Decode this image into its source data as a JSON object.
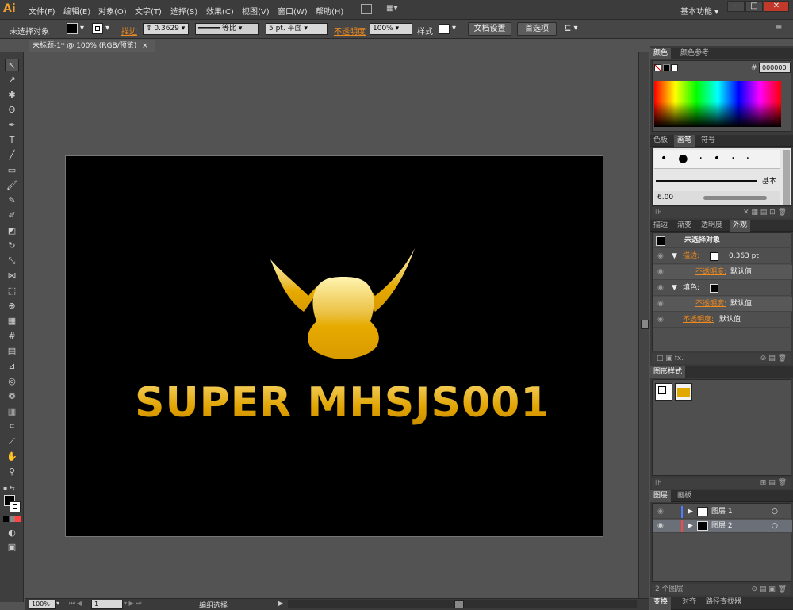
{
  "app": {
    "logo": "Ai",
    "workspace": "基本功能"
  },
  "menu": [
    "文件(F)",
    "编辑(E)",
    "对象(O)",
    "文字(T)",
    "选择(S)",
    "效果(C)",
    "视图(V)",
    "窗口(W)",
    "帮助(H)"
  ],
  "window_buttons": {
    "min": "–",
    "max": "□",
    "close": "✕"
  },
  "control": {
    "selection": "未选择对象",
    "stroke_label": "描边",
    "stroke_value": "0.3629",
    "stroke_profile": "等比",
    "brush": "5 pt. 平面",
    "opacity_label": "不透明度",
    "opacity_value": "100%",
    "style_label": "样式",
    "doc_setup": "文档设置",
    "prefs": "首选项"
  },
  "doc_tab": {
    "title": "未标题-1* @ 100% (RGB/预览)",
    "close": "×"
  },
  "artwork": {
    "text": "SUPER MHSJS001",
    "gold_light": "#f7d56a",
    "gold_dark": "#e0a300"
  },
  "color_panel": {
    "tabs": [
      "颜色",
      "颜色参考"
    ],
    "hex_label": "#",
    "hex": "000000"
  },
  "brush_panel": {
    "tabs": [
      "色板",
      "画笔",
      "符号"
    ],
    "basic": "基本",
    "size": "6.00"
  },
  "appearance": {
    "tabs": [
      "描边",
      "渐变",
      "透明度",
      "外观"
    ],
    "header": "未选择对象",
    "rows": [
      {
        "label": "描边:",
        "value": "0.363 pt"
      },
      {
        "label": "不透明度:",
        "value": "默认值"
      },
      {
        "label": "填色:",
        "value": ""
      },
      {
        "label": "不透明度:",
        "value": "默认值"
      },
      {
        "label": "不透明度:",
        "value": "默认值"
      }
    ]
  },
  "graphic_styles": {
    "tabs": [
      "图形样式"
    ]
  },
  "layers": {
    "tabs": [
      "图层",
      "画板"
    ],
    "items": [
      {
        "name": "图层 1",
        "color": "#4f7bff"
      },
      {
        "name": "图层 2",
        "color": "#ff4444"
      }
    ],
    "count": "2 个图层"
  },
  "bottom_tabs": [
    "变换",
    "对齐",
    "路径查找器"
  ],
  "status": {
    "zoom": "100%",
    "page": "1",
    "mode": "编组选择"
  }
}
